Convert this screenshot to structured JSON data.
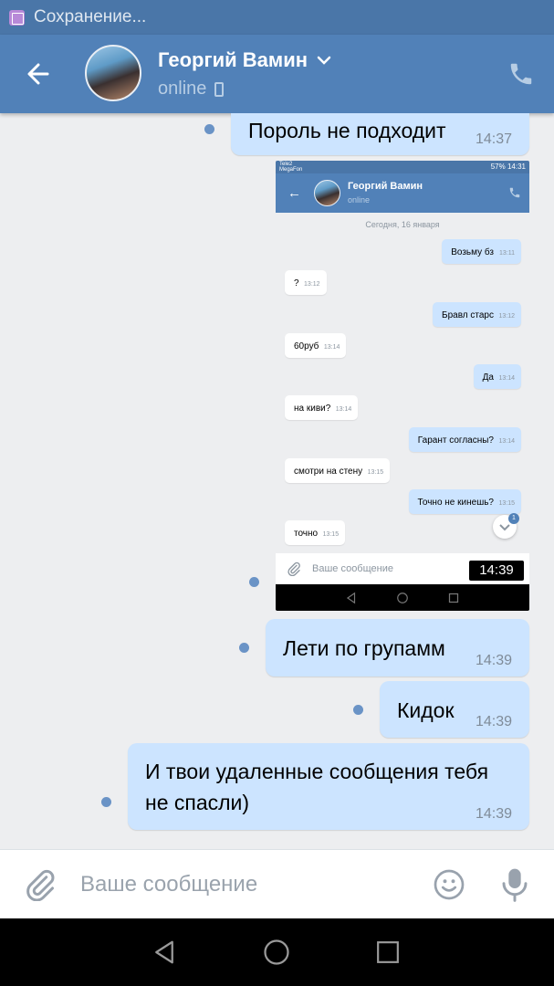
{
  "status_bar": {
    "notification_text": "Сохранение..."
  },
  "header": {
    "contact_name": "Георгий Вамин",
    "contact_status": "online"
  },
  "messages": [
    {
      "text": "Пороль не подходит",
      "time": "14:37"
    },
    {
      "text": "Лети по групамм",
      "time": "14:39"
    },
    {
      "text": "Кидок",
      "time": "14:39"
    },
    {
      "text": "И твои удаленные сообщения тебя не спасли)",
      "time": "14:39"
    }
  ],
  "screenshot_message": {
    "time_overlay": "14:39",
    "status": {
      "carrier_1": "Tele2",
      "carrier_2": "MegaFon",
      "battery": "57%",
      "clock": "14:31"
    },
    "contact_name": "Георгий Вамин",
    "contact_status": "online",
    "date": "Сегодня, 16 января",
    "messages": [
      {
        "text": "Возьму бз",
        "time": "13:11",
        "direction": "out"
      },
      {
        "text": "?",
        "time": "13:12",
        "direction": "in"
      },
      {
        "text": "Бравл старс",
        "time": "13:12",
        "direction": "out"
      },
      {
        "text": "60руб",
        "time": "13:14",
        "direction": "in"
      },
      {
        "text": "Да",
        "time": "13:14",
        "direction": "out"
      },
      {
        "text": "на киви?",
        "time": "13:14",
        "direction": "in"
      },
      {
        "text": "Гарант согласны?",
        "time": "13:14",
        "direction": "out"
      },
      {
        "text": "смотри на стену",
        "time": "13:15",
        "direction": "in"
      },
      {
        "text": "Точно не кинешь?",
        "time": "13:15",
        "direction": "out"
      },
      {
        "text": "точно",
        "time": "13:15",
        "direction": "in"
      }
    ],
    "input_placeholder": "Ваше сообщение",
    "scroll_badge": "1"
  },
  "composer": {
    "placeholder": "Ваше сообщение"
  },
  "colors": {
    "header": "#5181b8",
    "status_bar": "#4a76a8",
    "outgoing_bubble": "#cce4ff",
    "chat_background": "#edeef0",
    "unread_dot": "#6a93c6"
  },
  "icons": {
    "status_bar": "image-icon",
    "header_left": "back-arrow-icon",
    "header_name": "chevron-down-icon",
    "header_status": "mobile-phone-icon",
    "header_right": "phone-call-icon",
    "composer_left": "paperclip-icon",
    "composer_emoji": "smile-icon",
    "composer_right": "microphone-icon",
    "nav": [
      "nav-back-icon",
      "nav-home-icon",
      "nav-recents-icon"
    ]
  }
}
